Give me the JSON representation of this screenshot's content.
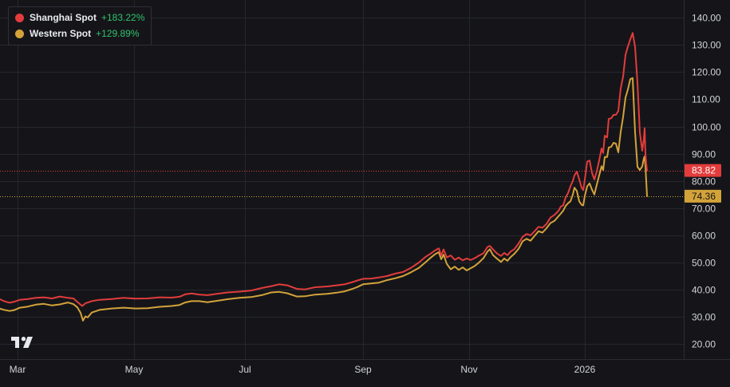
{
  "legend": [
    {
      "name": "Shanghai Spot",
      "change": "+183.22%",
      "color": "#e23c3c"
    },
    {
      "name": "Western Spot",
      "change": "+129.89%",
      "color": "#d3a33a"
    }
  ],
  "change_color": "#2fc26e",
  "price_labels": [
    {
      "value": "83.82",
      "color": "#e23c3c"
    },
    {
      "value": "74.36",
      "color": "#d3a33a"
    }
  ],
  "logo": {
    "name": "tradingview-logo"
  },
  "chart_data": {
    "type": "line",
    "y_ticks": [
      "140.00",
      "130.00",
      "120.00",
      "110.00",
      "100.00",
      "90.00",
      "80.00",
      "70.00",
      "60.00",
      "50.00",
      "40.00",
      "30.00",
      "20.00"
    ],
    "x_ticks": [
      "Mar",
      "May",
      "Jul",
      "Sep",
      "Nov",
      "2026"
    ],
    "ylim": [
      14.5,
      146.5
    ],
    "grid": true,
    "legend_position": "top-left",
    "series": [
      {
        "name": "Shanghai Spot",
        "color": "#e23c3c",
        "last_value": 83.82,
        "points": [
          [
            0,
            36.5
          ],
          [
            5,
            35.8
          ],
          [
            12,
            35.2
          ],
          [
            18,
            35.6
          ],
          [
            25,
            36.3
          ],
          [
            35,
            36.6
          ],
          [
            45,
            37.0
          ],
          [
            55,
            37.2
          ],
          [
            65,
            36.8
          ],
          [
            75,
            37.5
          ],
          [
            85,
            37.0
          ],
          [
            92,
            36.8
          ],
          [
            97,
            35.5
          ],
          [
            103,
            34.0
          ],
          [
            107,
            35.0
          ],
          [
            115,
            35.8
          ],
          [
            125,
            36.3
          ],
          [
            140,
            36.6
          ],
          [
            155,
            37.0
          ],
          [
            170,
            36.7
          ],
          [
            185,
            36.8
          ],
          [
            200,
            37.2
          ],
          [
            215,
            37.1
          ],
          [
            225,
            37.4
          ],
          [
            232,
            38.3
          ],
          [
            240,
            38.6
          ],
          [
            250,
            38.2
          ],
          [
            260,
            38.0
          ],
          [
            272,
            38.5
          ],
          [
            285,
            39.0
          ],
          [
            300,
            39.3
          ],
          [
            315,
            39.7
          ],
          [
            328,
            40.6
          ],
          [
            340,
            41.3
          ],
          [
            350,
            42.0
          ],
          [
            360,
            41.6
          ],
          [
            372,
            40.3
          ],
          [
            382,
            40.1
          ],
          [
            395,
            40.9
          ],
          [
            410,
            41.2
          ],
          [
            422,
            41.6
          ],
          [
            432,
            42.0
          ],
          [
            442,
            42.8
          ],
          [
            448,
            43.4
          ],
          [
            455,
            44.0
          ],
          [
            465,
            44.1
          ],
          [
            475,
            44.5
          ],
          [
            485,
            45.0
          ],
          [
            495,
            45.9
          ],
          [
            505,
            46.5
          ],
          [
            515,
            48.0
          ],
          [
            525,
            50.0
          ],
          [
            533,
            52.0
          ],
          [
            540,
            53.3
          ],
          [
            545,
            54.4
          ],
          [
            550,
            55.2
          ],
          [
            553,
            52.6
          ],
          [
            556,
            54.8
          ],
          [
            560,
            51.9
          ],
          [
            565,
            52.6
          ],
          [
            570,
            51.0
          ],
          [
            575,
            51.8
          ],
          [
            580,
            50.8
          ],
          [
            585,
            51.5
          ],
          [
            590,
            50.9
          ],
          [
            595,
            51.6
          ],
          [
            600,
            52.5
          ],
          [
            606,
            53.4
          ],
          [
            611,
            55.7
          ],
          [
            614,
            56.1
          ],
          [
            618,
            54.8
          ],
          [
            623,
            53.3
          ],
          [
            628,
            52.4
          ],
          [
            632,
            53.5
          ],
          [
            636,
            52.7
          ],
          [
            640,
            54.0
          ],
          [
            645,
            55.0
          ],
          [
            650,
            57.0
          ],
          [
            655,
            59.4
          ],
          [
            660,
            60.5
          ],
          [
            665,
            60.0
          ],
          [
            670,
            61.5
          ],
          [
            675,
            63.1
          ],
          [
            680,
            62.8
          ],
          [
            685,
            64.2
          ],
          [
            690,
            66.5
          ],
          [
            695,
            67.5
          ],
          [
            700,
            69.0
          ],
          [
            703,
            70.6
          ],
          [
            706,
            71.0
          ],
          [
            709,
            74.0
          ],
          [
            712,
            75.5
          ],
          [
            715,
            78.0
          ],
          [
            718,
            80.0
          ],
          [
            720,
            82.0
          ],
          [
            723,
            83.4
          ],
          [
            726,
            80.6
          ],
          [
            729,
            77.5
          ],
          [
            731,
            76.6
          ],
          [
            733,
            80.4
          ],
          [
            736,
            87.1
          ],
          [
            739,
            87.5
          ],
          [
            742,
            83.0
          ],
          [
            745,
            80.5
          ],
          [
            748,
            83.5
          ],
          [
            751,
            87.5
          ],
          [
            754,
            91.9
          ],
          [
            756,
            90.3
          ],
          [
            758,
            96.6
          ],
          [
            761,
            96.0
          ],
          [
            763,
            102.8
          ],
          [
            766,
            103.0
          ],
          [
            769,
            104.3
          ],
          [
            772,
            104.3
          ],
          [
            775,
            105.7
          ],
          [
            778,
            114.0
          ],
          [
            781,
            118.3
          ],
          [
            784,
            126.3
          ],
          [
            787,
            129.4
          ],
          [
            790,
            132.0
          ],
          [
            793,
            134.4
          ],
          [
            796,
            129.3
          ],
          [
            799,
            116.0
          ],
          [
            802,
            97.8
          ],
          [
            805,
            91.1
          ],
          [
            807,
            95.4
          ],
          [
            808,
            99.4
          ],
          [
            809,
            90.0
          ],
          [
            810,
            86.5
          ],
          [
            811,
            83.82
          ]
        ]
      },
      {
        "name": "Western Spot",
        "color": "#d3a33a",
        "last_value": 74.36,
        "points": [
          [
            0,
            33.0
          ],
          [
            5,
            32.6
          ],
          [
            12,
            32.2
          ],
          [
            18,
            32.5
          ],
          [
            25,
            33.4
          ],
          [
            35,
            33.8
          ],
          [
            45,
            34.5
          ],
          [
            55,
            34.8
          ],
          [
            65,
            34.2
          ],
          [
            75,
            34.6
          ],
          [
            85,
            35.3
          ],
          [
            92,
            34.7
          ],
          [
            97,
            33.5
          ],
          [
            101,
            31.5
          ],
          [
            104,
            28.6
          ],
          [
            107,
            30.2
          ],
          [
            110,
            29.8
          ],
          [
            115,
            31.6
          ],
          [
            125,
            32.6
          ],
          [
            140,
            33.1
          ],
          [
            155,
            33.4
          ],
          [
            170,
            33.1
          ],
          [
            185,
            33.2
          ],
          [
            200,
            33.7
          ],
          [
            215,
            34.0
          ],
          [
            225,
            34.4
          ],
          [
            232,
            35.3
          ],
          [
            240,
            35.8
          ],
          [
            250,
            35.8
          ],
          [
            260,
            35.4
          ],
          [
            272,
            35.9
          ],
          [
            285,
            36.5
          ],
          [
            300,
            37.0
          ],
          [
            315,
            37.3
          ],
          [
            328,
            38.0
          ],
          [
            340,
            39.0
          ],
          [
            350,
            39.2
          ],
          [
            360,
            38.7
          ],
          [
            372,
            37.5
          ],
          [
            382,
            37.6
          ],
          [
            395,
            38.2
          ],
          [
            410,
            38.5
          ],
          [
            422,
            38.9
          ],
          [
            432,
            39.4
          ],
          [
            442,
            40.3
          ],
          [
            448,
            41.0
          ],
          [
            455,
            42.0
          ],
          [
            465,
            42.3
          ],
          [
            475,
            42.6
          ],
          [
            485,
            43.5
          ],
          [
            495,
            44.2
          ],
          [
            505,
            45.0
          ],
          [
            515,
            46.4
          ],
          [
            525,
            48.0
          ],
          [
            533,
            50.0
          ],
          [
            540,
            51.8
          ],
          [
            545,
            53.0
          ],
          [
            550,
            53.8
          ],
          [
            553,
            51.2
          ],
          [
            556,
            52.9
          ],
          [
            560,
            49.5
          ],
          [
            565,
            47.5
          ],
          [
            570,
            48.5
          ],
          [
            575,
            47.3
          ],
          [
            580,
            48.2
          ],
          [
            585,
            47.1
          ],
          [
            590,
            47.9
          ],
          [
            595,
            48.7
          ],
          [
            600,
            49.9
          ],
          [
            606,
            51.6
          ],
          [
            611,
            54.0
          ],
          [
            614,
            54.9
          ],
          [
            618,
            52.7
          ],
          [
            623,
            51.4
          ],
          [
            628,
            50.2
          ],
          [
            632,
            51.5
          ],
          [
            636,
            50.6
          ],
          [
            640,
            52.0
          ],
          [
            645,
            53.3
          ],
          [
            650,
            55.0
          ],
          [
            655,
            57.8
          ],
          [
            660,
            58.7
          ],
          [
            665,
            58.0
          ],
          [
            670,
            59.8
          ],
          [
            675,
            61.5
          ],
          [
            680,
            61.0
          ],
          [
            685,
            62.6
          ],
          [
            690,
            64.5
          ],
          [
            695,
            65.3
          ],
          [
            700,
            67.0
          ],
          [
            703,
            68.0
          ],
          [
            706,
            69.1
          ],
          [
            709,
            70.8
          ],
          [
            712,
            71.8
          ],
          [
            715,
            72.5
          ],
          [
            718,
            75.0
          ],
          [
            720,
            77.5
          ],
          [
            723,
            76.3
          ],
          [
            726,
            72.5
          ],
          [
            729,
            71.2
          ],
          [
            731,
            71.0
          ],
          [
            733,
            74.5
          ],
          [
            736,
            78.0
          ],
          [
            739,
            79.1
          ],
          [
            742,
            76.8
          ],
          [
            745,
            75.0
          ],
          [
            748,
            78.6
          ],
          [
            751,
            82.0
          ],
          [
            754,
            85.4
          ],
          [
            756,
            84.0
          ],
          [
            758,
            88.8
          ],
          [
            761,
            88.8
          ],
          [
            763,
            92.3
          ],
          [
            766,
            92.5
          ],
          [
            769,
            94.0
          ],
          [
            772,
            93.7
          ],
          [
            775,
            90.5
          ],
          [
            778,
            98.0
          ],
          [
            781,
            103.5
          ],
          [
            784,
            110.6
          ],
          [
            787,
            113.6
          ],
          [
            790,
            117.4
          ],
          [
            793,
            117.8
          ],
          [
            796,
            98.0
          ],
          [
            799,
            85.2
          ],
          [
            802,
            84.0
          ],
          [
            805,
            85.3
          ],
          [
            807,
            88.3
          ],
          [
            808,
            89.0
          ],
          [
            809,
            85.5
          ],
          [
            810,
            80.0
          ],
          [
            811,
            74.36
          ]
        ]
      }
    ]
  }
}
